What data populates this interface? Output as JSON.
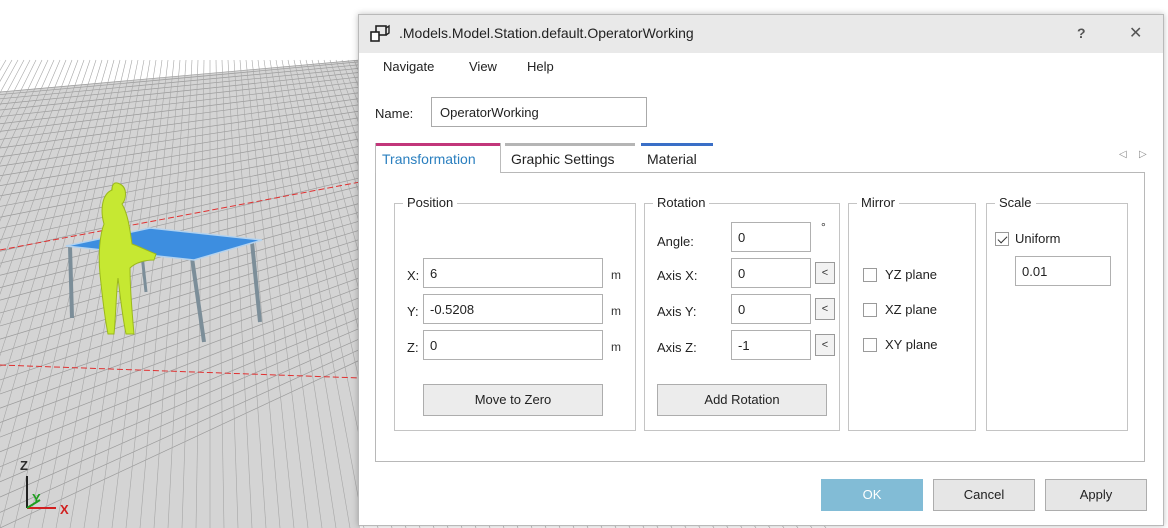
{
  "viewport": {
    "axes": {
      "z": "Z",
      "y": "Y",
      "x": "X"
    }
  },
  "dialog": {
    "title": ".Models.Model.Station.default.OperatorWorking",
    "help_label": "?",
    "close_label": "✕",
    "menu": [
      "Navigate",
      "View",
      "Help"
    ],
    "name_label": "Name:",
    "name_value": "OperatorWorking",
    "tabs": [
      {
        "label": "Transformation",
        "color": "#c2367a"
      },
      {
        "label": "Graphic Settings",
        "color": "#b5b5b5"
      },
      {
        "label": "Material",
        "color": "#3a6fc7"
      }
    ],
    "scroll_left": "◁",
    "scroll_right": "▷",
    "position": {
      "title": "Position",
      "x_label": "X:",
      "x_value": "6",
      "x_unit": "m",
      "y_label": "Y:",
      "y_value": "-0.5208",
      "y_unit": "m",
      "z_label": "Z:",
      "z_value": "0",
      "z_unit": "m",
      "button": "Move to Zero"
    },
    "rotation": {
      "title": "Rotation",
      "angle_label": "Angle:",
      "angle_value": "0",
      "angle_unit": "°",
      "axis_x_label": "Axis X:",
      "axis_x_value": "0",
      "axis_y_label": "Axis Y:",
      "axis_y_value": "0",
      "axis_z_label": "Axis Z:",
      "axis_z_value": "-1",
      "pick": "<",
      "button": "Add Rotation"
    },
    "mirror": {
      "title": "Mirror",
      "yz": "YZ plane",
      "xz": "XZ plane",
      "xy": "XY plane"
    },
    "scale": {
      "title": "Scale",
      "uniform": "Uniform",
      "value": "0.01"
    },
    "footer": {
      "ok": "OK",
      "cancel": "Cancel",
      "apply": "Apply"
    }
  }
}
